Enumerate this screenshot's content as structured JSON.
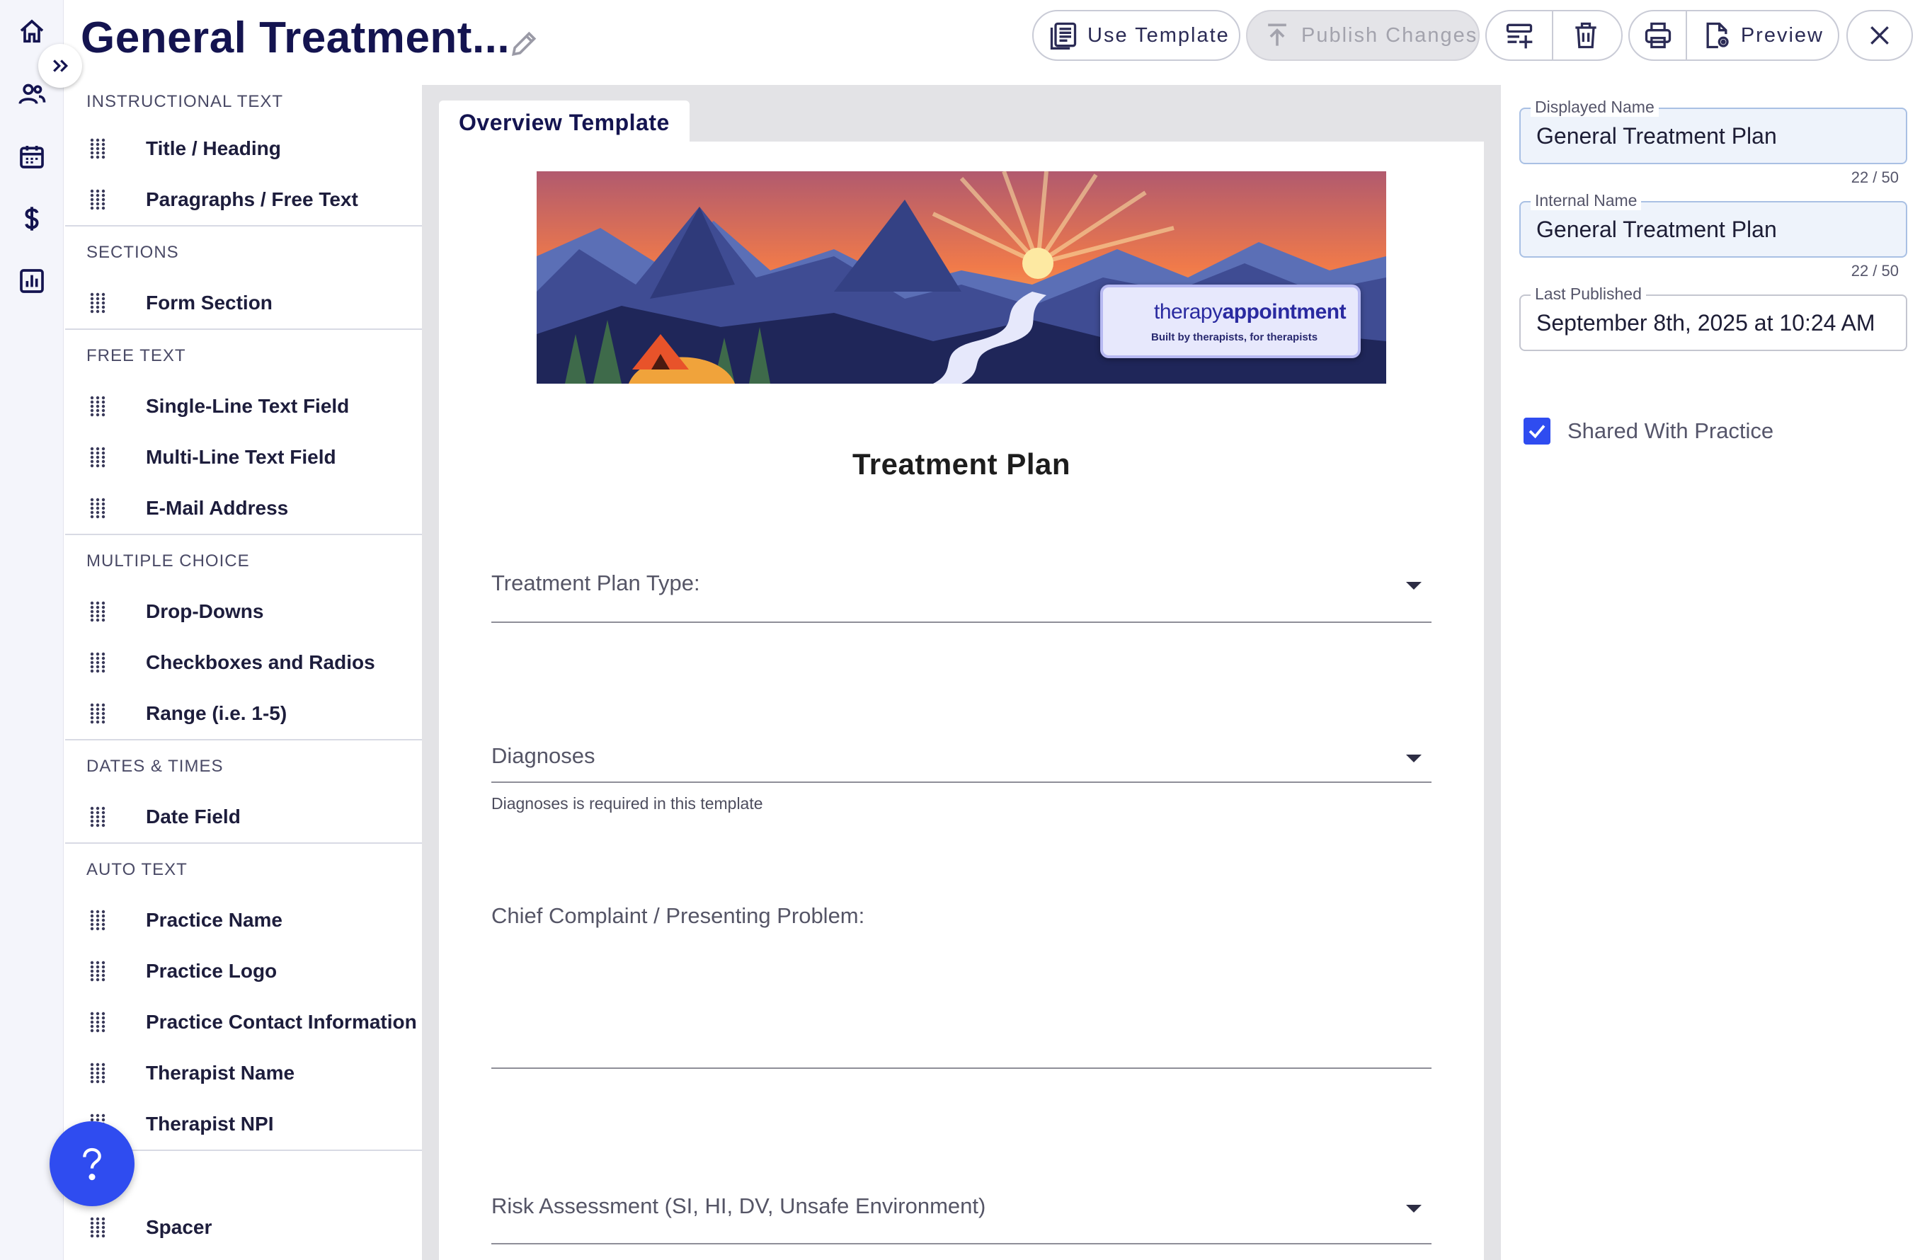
{
  "header": {
    "title": "General Treatment...",
    "toolbar": {
      "use_template": "Use Template",
      "publish_changes": "Publish Changes",
      "preview": "Preview"
    }
  },
  "palette": {
    "categories": [
      {
        "label": "INSTRUCTIONAL TEXT",
        "items": [
          "Title / Heading",
          "Paragraphs / Free Text"
        ]
      },
      {
        "label": "SECTIONS",
        "items": [
          "Form Section"
        ]
      },
      {
        "label": "FREE TEXT",
        "items": [
          "Single-Line Text Field",
          "Multi-Line Text Field",
          "E-Mail Address"
        ]
      },
      {
        "label": "MULTIPLE CHOICE",
        "items": [
          "Drop-Downs",
          "Checkboxes and Radios",
          "Range (i.e. 1-5)"
        ]
      },
      {
        "label": "DATES & TIMES",
        "items": [
          "Date Field"
        ]
      },
      {
        "label": "AUTO TEXT",
        "items": [
          "Practice Name",
          "Practice Logo",
          "Practice Contact Information",
          "Therapist Name",
          "Therapist NPI"
        ]
      },
      {
        "label": "UT",
        "items": [
          "Spacer"
        ]
      }
    ]
  },
  "canvas": {
    "tab_label": "Overview Template",
    "banner": {
      "brand_light": "therapy",
      "brand_bold": "appointment",
      "tagline": "Built by therapists, for therapists"
    },
    "doc_title": "Treatment Plan",
    "fields": {
      "plan_type": "Treatment Plan Type:",
      "diagnoses": "Diagnoses",
      "diagnoses_hint": "Diagnoses is required in this template",
      "chief_complaint": "Chief Complaint / Presenting Problem:",
      "risk": "Risk Assessment (SI, HI, DV, Unsafe Environment)"
    }
  },
  "properties": {
    "displayed_name": {
      "label": "Displayed Name",
      "value": "General Treatment Plan",
      "counter": "22 / 50"
    },
    "internal_name": {
      "label": "Internal Name",
      "value": "General Treatment Plan",
      "counter": "22 / 50"
    },
    "last_published": {
      "label": "Last Published",
      "value": "September 8th, 2025 at 10:24 AM"
    },
    "shared_label": "Shared With Practice",
    "shared_checked": true
  },
  "colors": {
    "accent": "#2f4cf0",
    "title": "#141450",
    "canvas_bg": "#e3e3e6"
  }
}
